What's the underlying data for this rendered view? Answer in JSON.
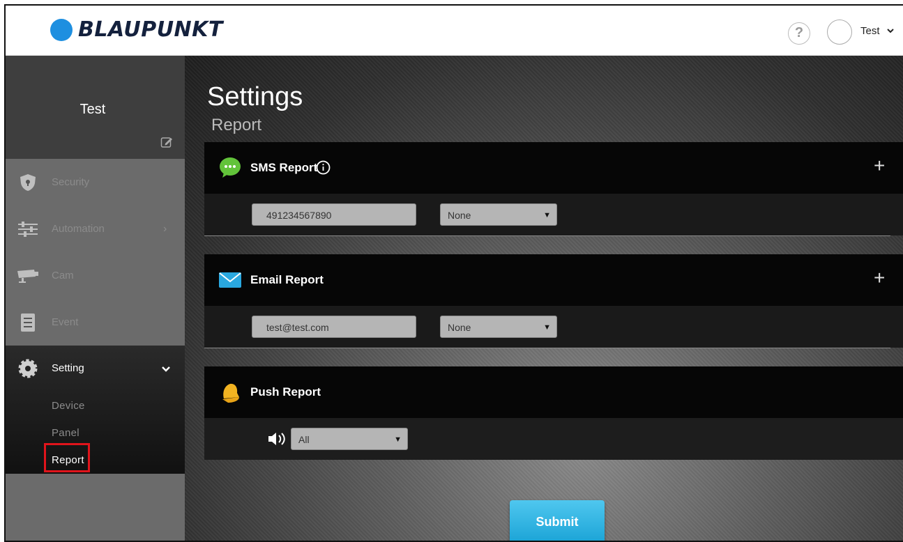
{
  "header": {
    "brand": "BLAUPUNKT",
    "help_label": "?",
    "user_name": "Test",
    "brand_color": "#1e8fe0"
  },
  "sidebar": {
    "profile_name": "Test",
    "items": [
      {
        "label": "Security",
        "icon": "shield-icon"
      },
      {
        "label": "Automation",
        "icon": "sliders-icon",
        "arrow": "›"
      },
      {
        "label": "Cam",
        "icon": "camera-icon"
      },
      {
        "label": "Event",
        "icon": "list-icon"
      }
    ],
    "setting": {
      "label": "Setting",
      "icon": "gear-icon",
      "sub_items": [
        "Device",
        "Panel",
        "Report"
      ]
    }
  },
  "main": {
    "title": "Settings",
    "subtitle": "Report",
    "sms": {
      "title": "SMS Report",
      "phone": "491234567890",
      "option": "None"
    },
    "email": {
      "title": "Email Report",
      "address": "test@test.com",
      "option": "None"
    },
    "push": {
      "title": "Push Report",
      "option": "All"
    },
    "submit_label": "Submit",
    "accent_color": "#1aa3d6",
    "highlight_color": "#e0141b"
  }
}
